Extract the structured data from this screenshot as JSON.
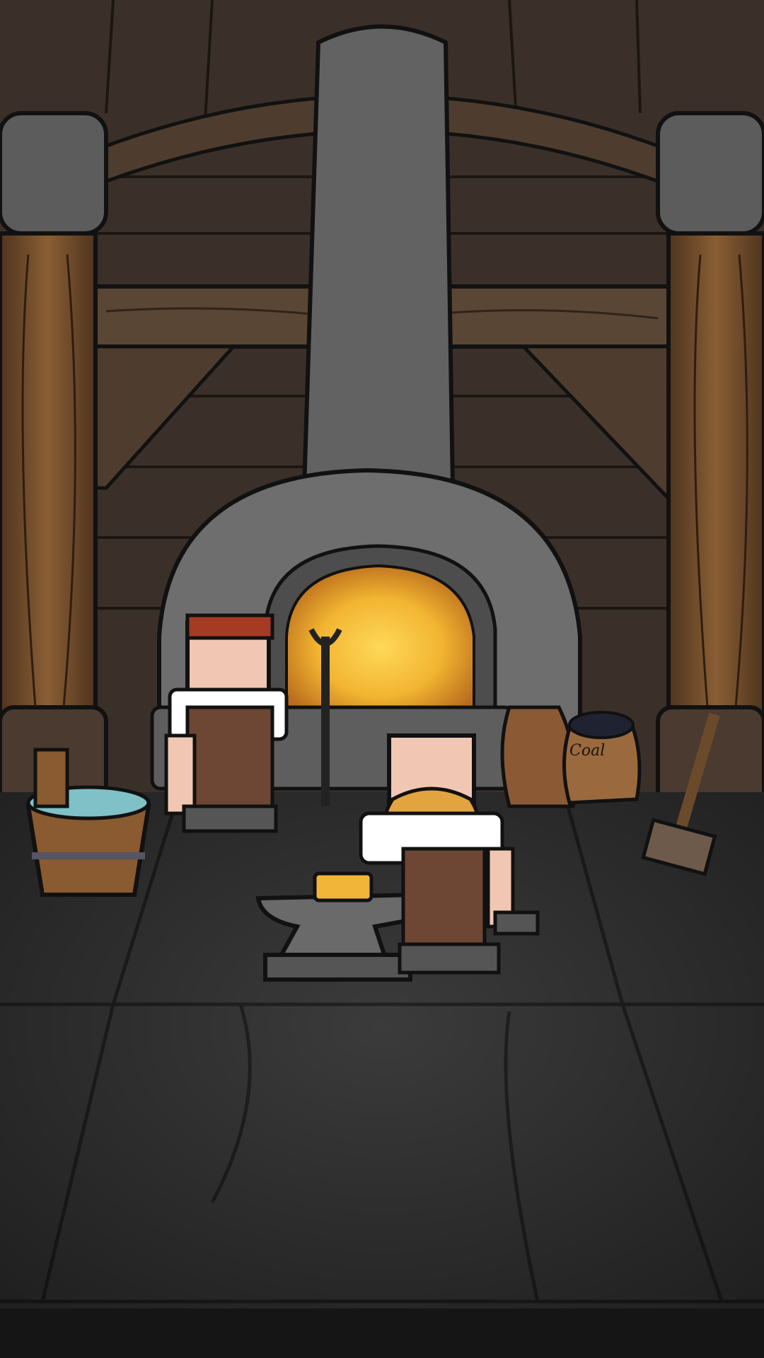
{
  "scene": {
    "name": "blacksmith-forge",
    "coal_sack_label": "Coal"
  },
  "colors": {
    "wall_wood": "#3b3029",
    "wall_wood_dark": "#2a221d",
    "beam_wood": "#5a4634",
    "pillar_wood": "#6b4a2c",
    "stone_grey": "#6e6e6e",
    "chimney_grey": "#626262",
    "fire_glow": "#f2b531",
    "floor_stone": "#3b3b3b",
    "floor_dark": "#2c2c2c",
    "bottom_bar": "#151515",
    "apron_brown": "#6e4634",
    "skin": "#f1c7b3",
    "mustache": "#e2a43f",
    "bandana_red": "#a43b22",
    "gold_bar": "#f1b53a",
    "water": "#7fc1c6"
  }
}
